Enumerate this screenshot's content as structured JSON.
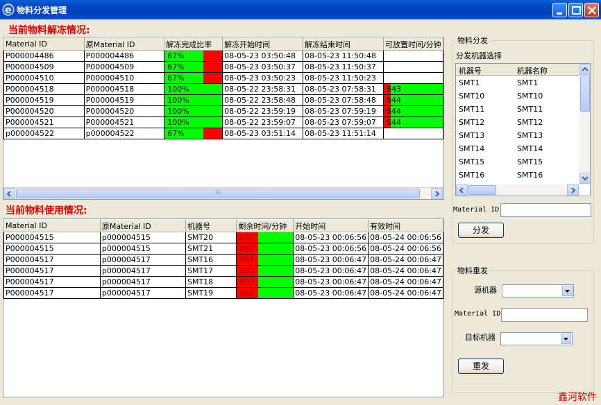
{
  "window": {
    "title": "物料分发管理"
  },
  "thaw_section": {
    "title": "当前物料解冻情况:",
    "columns": [
      "Material ID",
      "原Material ID",
      "解冻完成比率",
      "解冻开始时间",
      "解冻结束时间",
      "可放置时间/分钟"
    ],
    "rows": [
      {
        "id": "P000004486",
        "orig": "P000004486",
        "ratio": "67%",
        "ratio_value": 0.67,
        "start": "08-05-23  03:50:48",
        "end": "08-05-23  11:50:48",
        "avail": "",
        "avail_value": 0
      },
      {
        "id": "P000004509",
        "orig": "P000004509",
        "ratio": "67%",
        "ratio_value": 0.67,
        "start": "08-05-23  03:50:37",
        "end": "08-05-23  11:50:37",
        "avail": "",
        "avail_value": 0
      },
      {
        "id": "P000004510",
        "orig": "P000004510",
        "ratio": "67%",
        "ratio_value": 0.67,
        "start": "08-05-23  03:50:23",
        "end": "08-05-23  11:50:23",
        "avail": "",
        "avail_value": 0
      },
      {
        "id": "P000004518",
        "orig": "P000004518",
        "ratio": "100%",
        "ratio_value": 1.0,
        "start": "08-05-22  23:58:31",
        "end": "08-05-23  07:58:31",
        "avail": "643",
        "avail_value": 0.88
      },
      {
        "id": "P000004519",
        "orig": "P000004519",
        "ratio": "100%",
        "ratio_value": 1.0,
        "start": "08-05-22  23:58:48",
        "end": "08-05-23  07:58:48",
        "avail": "644",
        "avail_value": 0.88
      },
      {
        "id": "P000004520",
        "orig": "P000004520",
        "ratio": "100%",
        "ratio_value": 1.0,
        "start": "08-05-22  23:59:19",
        "end": "08-05-23  07:59:19",
        "avail": "644",
        "avail_value": 0.88
      },
      {
        "id": "P000004521",
        "orig": "P000004521",
        "ratio": "100%",
        "ratio_value": 1.0,
        "start": "08-05-22  23:59:07",
        "end": "08-05-23  07:59:07",
        "avail": "644",
        "avail_value": 0.88
      },
      {
        "id": "p000004522",
        "orig": "p000004522",
        "ratio": "67%",
        "ratio_value": 0.67,
        "start": "08-05-23  03:51:14",
        "end": "08-05-23  11:51:14",
        "avail": "",
        "avail_value": 0
      }
    ],
    "scroll_thumb_glyph": "III"
  },
  "usage_section": {
    "title": "当前物料使用情况:",
    "columns": [
      "Material ID",
      "原Material ID",
      "机器号",
      "剩余时间/分钟",
      "开始时间",
      "有效时间"
    ],
    "rows": [
      {
        "id": "P000004515",
        "orig": "p000004515",
        "machine": "SMT20",
        "remain": "892",
        "remain_value": 0.38,
        "start": "08-05-23 00:06:56",
        "valid": "08-05-24 00:06:56"
      },
      {
        "id": "P000004515",
        "orig": "p000004515",
        "machine": "SMT21",
        "remain": "892",
        "remain_value": 0.38,
        "start": "08-05-23 00:06:56",
        "valid": "08-05-24 00:06:56"
      },
      {
        "id": "P000004517",
        "orig": "p000004517",
        "machine": "SMT16",
        "remain": "892",
        "remain_value": 0.38,
        "start": "08-05-23 00:06:47",
        "valid": "08-05-24 00:06:47"
      },
      {
        "id": "P000004517",
        "orig": "p000004517",
        "machine": "SMT17",
        "remain": "892",
        "remain_value": 0.38,
        "start": "08-05-23 00:06:47",
        "valid": "08-05-24 00:06:47"
      },
      {
        "id": "P000004517",
        "orig": "p000004517",
        "machine": "SMT18",
        "remain": "892",
        "remain_value": 0.38,
        "start": "08-05-23 00:06:47",
        "valid": "08-05-24 00:06:47"
      },
      {
        "id": "P000004517",
        "orig": "p000004517",
        "machine": "SMT19",
        "remain": "892",
        "remain_value": 0.38,
        "start": "08-05-23 00:06:47",
        "valid": "08-05-24 00:06:47"
      }
    ]
  },
  "distribute": {
    "group_label": "物料分发",
    "select_label": "分发机器选择",
    "list_columns": [
      "机器号",
      "机器名称"
    ],
    "machines": [
      {
        "no": "SMT1",
        "name": "SMT1"
      },
      {
        "no": "SMT10",
        "name": "SMT10"
      },
      {
        "no": "SMT11",
        "name": "SMT11"
      },
      {
        "no": "SMT12",
        "name": "SMT12"
      },
      {
        "no": "SMT13",
        "name": "SMT13"
      },
      {
        "no": "SMT14",
        "name": "SMT14"
      },
      {
        "no": "SMT15",
        "name": "SMT15"
      },
      {
        "no": "SMT16",
        "name": "SMT16"
      }
    ],
    "material_id_label": "Material ID",
    "material_id_value": "",
    "button_label": "分发"
  },
  "resend": {
    "group_label": "物料重发",
    "source_label": "源机器",
    "source_value": "",
    "material_id_label": "Material ID",
    "material_id_value": "",
    "target_label": "目标机器",
    "target_value": "",
    "button_label": "重发"
  },
  "brand": "鑫河软件",
  "colors": {
    "progress_green": "#00ff00",
    "progress_red": "#ff0000",
    "title_red": "#e00000",
    "titlebar_blue": "#0248c8"
  }
}
